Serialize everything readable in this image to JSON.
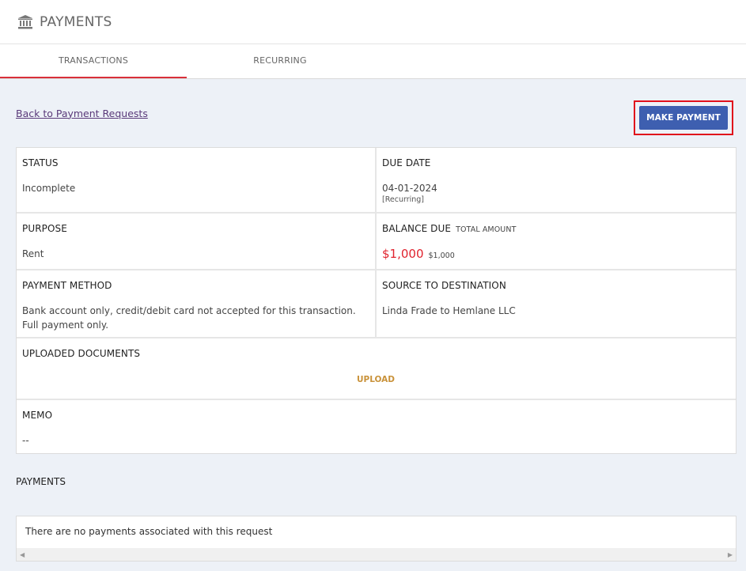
{
  "header": {
    "title": "PAYMENTS",
    "icon": "bank-icon"
  },
  "tabs": [
    {
      "label": "TRANSACTIONS",
      "active": true
    },
    {
      "label": "RECURRING",
      "active": false
    }
  ],
  "back_link": "Back to Payment Requests",
  "make_payment_label": "MAKE PAYMENT",
  "details": {
    "status_label": "STATUS",
    "status_value": "Incomplete",
    "due_date_label": "DUE DATE",
    "due_date_value": "04-01-2024",
    "due_date_note": "[Recurring]",
    "purpose_label": "PURPOSE",
    "purpose_value": "Rent",
    "balance_label": "BALANCE DUE",
    "total_label": "TOTAL AMOUNT",
    "balance_value": "$1,000",
    "total_value": "$1,000",
    "method_label": "PAYMENT METHOD",
    "method_value": "Bank account only, credit/debit card not accepted for this transaction. Full payment only.",
    "source_label": "SOURCE TO DESTINATION",
    "source_value": "Linda Frade to Hemlane LLC",
    "docs_label": "UPLOADED DOCUMENTS",
    "upload_label": "UPLOAD",
    "memo_label": "MEMO",
    "memo_value": "--"
  },
  "payments": {
    "title": "PAYMENTS",
    "empty_message": "There are no payments associated with this request"
  },
  "colors": {
    "accent_red": "#d9303a",
    "button_blue": "#3e5fb0",
    "balance_red": "#e0232e",
    "upload_gold": "#c9923a"
  }
}
